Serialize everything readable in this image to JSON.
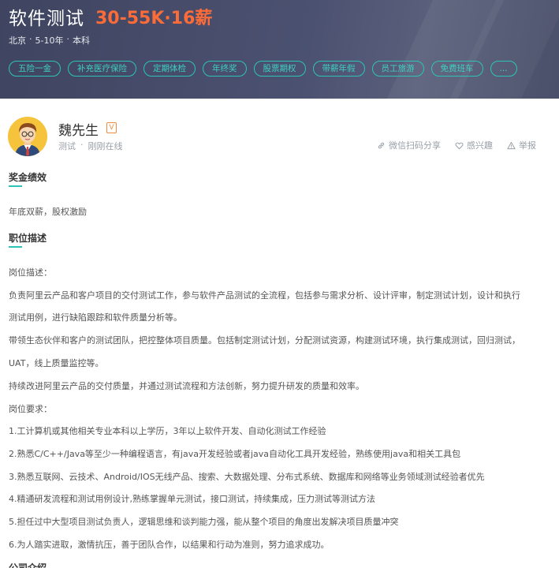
{
  "header": {
    "title": "软件测试",
    "salary": "30-55K·16薪",
    "meta": [
      "北京",
      "5-10年",
      "本科"
    ],
    "meta_separator": "·",
    "tags": [
      "五险一金",
      "补充医疗保险",
      "定期体检",
      "年终奖",
      "股票期权",
      "带薪年假",
      "员工旅游",
      "免费班车",
      "..."
    ]
  },
  "recruiter": {
    "name": "魏先生",
    "verified_badge": "V",
    "title": "测试",
    "status": "刚刚在线",
    "separator": "·",
    "actions": {
      "share": "微信扫码分享",
      "interest": "感兴趣",
      "report": "举报"
    }
  },
  "sections": {
    "bonus_title": "奖金绩效",
    "bonus_text": "年底双薪，股权激励",
    "desc_title": "职位描述",
    "desc_lines": [
      "岗位描述：",
      "负责阿里云产品和客户项目的交付测试工作，参与软件产品测试的全流程，包括参与需求分析、设计评审，制定测试计划，设计和执行",
      "测试用例，进行缺陷跟踪和软件质量分析等。",
      "带领生态伙伴和客户的测试团队，把控整体项目质量。包括制定测试计划，分配测试资源，构建测试环境，执行集成测试，回归测试，",
      "UAT，线上质量监控等。",
      "持续改进阿里云产品的交付质量，并通过测试流程和方法创新，努力提升研发的质量和效率。",
      "岗位要求：",
      "1.工计算机或其他相关专业本科以上学历，3年以上软件开发、自动化测试工作经验",
      "2.熟悉C/C++/Java等至少一种编程语言，有java开发经验或者java自动化工具开发经验，熟练使用java和相关工具包",
      "3.熟悉互联网、云技术、Android/IOS无线产品、搜索、大数据处理、分布式系统、数据库和网络等业务领域测试经验者优先",
      "4.精通研发流程和测试用例设计,熟练掌握单元测试，接口测试，持续集成，压力测试等测试方法",
      "5.担任过中大型项目测试负责人，逻辑思维和谈判能力强，能从整个项目的角度出发解决项目质量冲突",
      "6.为人踏实进取，激情抗压，善于团队合作，以结果和行动为准则，努力追求成功。"
    ],
    "company_title": "公司介绍"
  },
  "colors": {
    "header_bg": "#454b66",
    "salary": "#fc6c38",
    "accent_teal": "#2cc4b6",
    "verify_orange": "#f08a3c"
  }
}
